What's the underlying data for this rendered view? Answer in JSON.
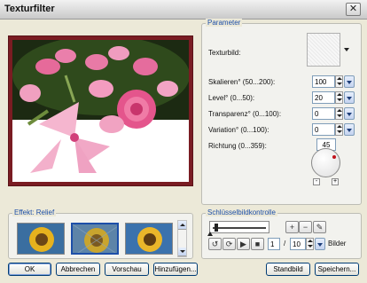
{
  "window": {
    "title": "Texturfilter",
    "close_glyph": "✕"
  },
  "parameter": {
    "group_label": "Parameter",
    "texture_label": "Texturbild:",
    "fields": [
      {
        "label": "Skalieren° (50...200):",
        "value": "100"
      },
      {
        "label": "Level° (0...50):",
        "value": "20"
      },
      {
        "label": "Transparenz° (0...100):",
        "value": "0"
      },
      {
        "label": "Variation° (0...100):",
        "value": "0"
      }
    ],
    "direction": {
      "label": "Richtung (0...359):",
      "value": "45"
    },
    "dial_minus": "-",
    "dial_plus": "+"
  },
  "effect": {
    "group_label": "Effekt: Relief",
    "selected_index": 1
  },
  "keyframe": {
    "group_label": "Schlüsselbildkontrolle",
    "frame_current": "1",
    "frame_separator": "/",
    "frame_total": "10",
    "frames_label": "Bilder",
    "icons": [
      "add-keyframe-icon",
      "remove-keyframe-icon",
      "keyframe-settings-icon",
      "loop-icon",
      "bounce-icon",
      "play-icon",
      "stop-icon"
    ]
  },
  "buttons": {
    "ok": "OK",
    "cancel": "Abbrechen",
    "preview": "Vorschau",
    "add": "Hinzufügen...",
    "still": "Standbild",
    "save": "Speichern..."
  },
  "colors": {
    "accent": "#1d4fa8",
    "frame": "#7a1c22",
    "bg": "#ece9d8"
  }
}
